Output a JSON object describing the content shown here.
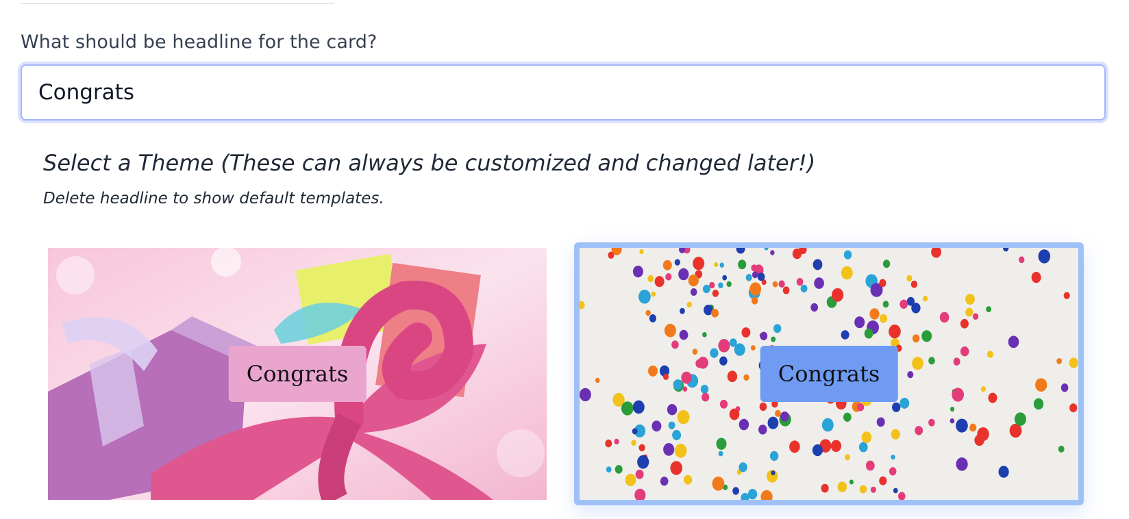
{
  "form": {
    "question_label": "What should be headline for the card?",
    "headline_value": "Congrats"
  },
  "themes": {
    "title": "Select a Theme (These can always be customized and changed later!)",
    "subtitle": "Delete headline to show default templates.",
    "cards": [
      {
        "name": "gift-box",
        "label": "Congrats",
        "label_color": "#eaa5cf",
        "selected": false
      },
      {
        "name": "balloons",
        "label": "Congrats",
        "label_color": "#6f9bf3",
        "selected": true
      }
    ]
  },
  "colors": {
    "input_border": "#a5b4fc",
    "selected_border": "#9fc1f7"
  }
}
